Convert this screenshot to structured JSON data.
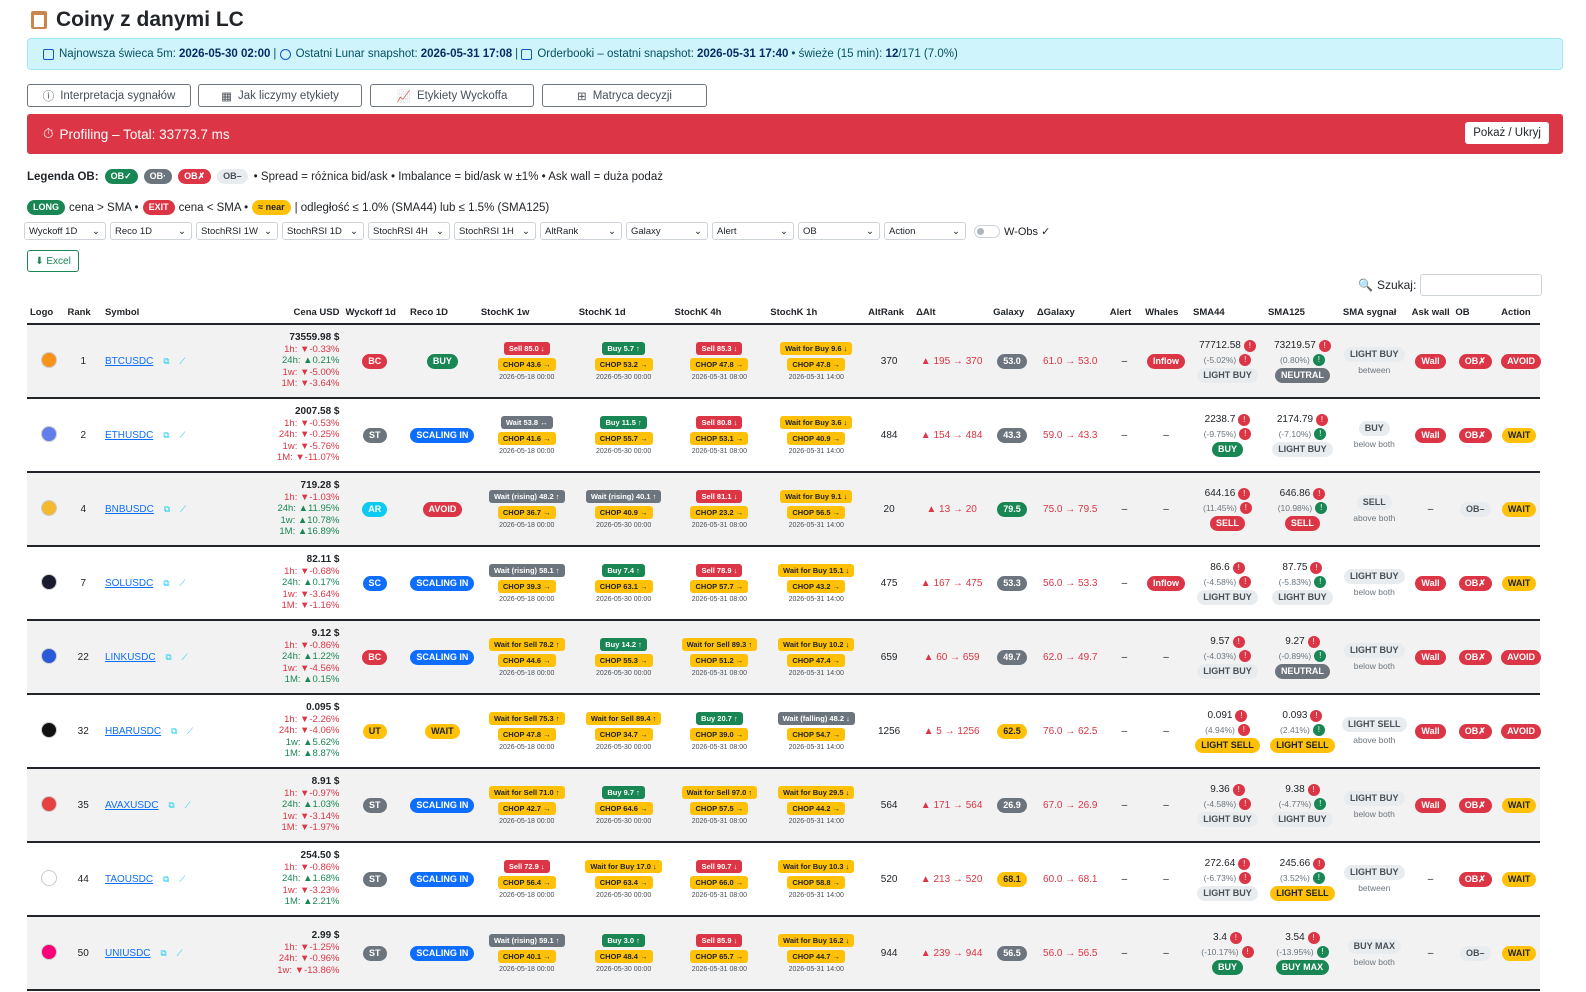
{
  "title": "Coiny z danymi LC",
  "info": {
    "candle_label": "Najnowsza świeca 5m:",
    "candle_val": "2026-05-30 02:00",
    "lunar_label": "Ostatni Lunar snapshot:",
    "lunar_val": "2026-05-31 17:08",
    "ob_label": "Orderbooki – ostatni snapshot:",
    "ob_val": "2026-05-31 17:40",
    "fresh_label": "• świeże (15 min):",
    "fresh_val": "12",
    "fresh_tail": "/171 (7.0%)"
  },
  "tabs": [
    "Interpretacja sygnałów",
    "Jak liczymy etykiety",
    "Etykiety Wyckoffa",
    "Matryca decyzji"
  ],
  "profiling": {
    "text": "Profiling – Total: 33773.7 ms",
    "toggle": "Pokaż / Ukryj"
  },
  "legend": {
    "label": "Legenda OB:",
    "ob_ok": "OB✓",
    "ob_neutral": "OB·",
    "ob_bad": "OB✗",
    "ob_none": "OB–",
    "desc": "• Spread = różnica bid/ask • Imbalance = bid/ask w ±1% • Ask wall = duża podaż"
  },
  "legend2": {
    "long": "LONG",
    "long_txt": "cena > SMA •",
    "exit": "EXIT",
    "exit_txt": "cena < SMA •",
    "near": "≈ near",
    "near_txt": "| odległość ≤ 1.0% (SMA44) lub ≤ 1.5% (SMA125)"
  },
  "filters": [
    "Wyckoff 1D",
    "Reco 1D",
    "StochRSI 1W",
    "StochRSI 1D",
    "StochRSI 4H",
    "StochRSI 1H",
    "AltRank",
    "Galaxy",
    "Alert",
    "OB",
    "Action"
  ],
  "wobs": "W-Obs ✓",
  "excel": "Excel",
  "search_label": "Szukaj:",
  "headers": [
    "Logo",
    "Rank",
    "Symbol",
    "Cena USD",
    "Wyckoff 1d",
    "Reco 1D",
    "StochK 1w",
    "StochK 1d",
    "StochK 4h",
    "StochK 1h",
    "AltRank",
    "ΔAlt",
    "Galaxy",
    "ΔGalaxy",
    "Alert",
    "Whales",
    "SMA44",
    "SMA125",
    "SMA sygnał",
    "Ask wall",
    "OB",
    "Action"
  ],
  "rows": [
    {
      "logo": "#f7931a",
      "rank": "1",
      "sym": "BTCUSDC",
      "price": "73559.98 $",
      "h1": "1h: ▼-0.33%",
      "h24": "24h: ▲0.21%",
      "w1": "1w: ▼-5.00%",
      "m1": "1M: ▼-3.64%",
      "wy": "BC",
      "wyc": "r",
      "reco": "BUY",
      "recoc": "g",
      "s1": [
        "Sell 85.0 ↓",
        "r",
        "CHOP 43.6 →",
        "2026-05-18 00:00"
      ],
      "s2": [
        "Buy 5.7 ↑",
        "g",
        "CHOP 53.2 →",
        "2026-05-30 00:00"
      ],
      "s3": [
        "Sell 85.3 ↓",
        "r",
        "CHOP 47.8 →",
        "2026-05-31 08:00"
      ],
      "s4": [
        "Wait for Buy 9.6 ↓",
        "y",
        "CHOP 47.8 →",
        "2026-05-31 14:00"
      ],
      "alt": "370",
      "dalt": "▲ 195 → 370",
      "gal": "53.0",
      "galc": "gr",
      "dgal": "61.0 → 53.0",
      "alert": "–",
      "whale": "Inflow",
      "sma44": "77712.58",
      "sma44p": "(-5.02%)",
      "sma44l": "LIGHT BUY",
      "sma44c": "lg",
      "sma125": "73219.57",
      "sma125p": "(0.80%)",
      "sma125l": "NEUTRAL",
      "sma125c": "gr",
      "sig": "LIGHT BUY",
      "sigsub": "between",
      "ask": "Wall",
      "ob": "OB✗",
      "act": "AVOID",
      "actc": "r"
    },
    {
      "logo": "#627eea",
      "rank": "2",
      "sym": "ETHUSDC",
      "price": "2007.58 $",
      "h1": "1h: ▼-0.53%",
      "h24": "24h: ▼-0.25%",
      "w1": "1w: ▼-5.76%",
      "m1": "1M: ▼-11.07%",
      "wy": "ST",
      "wyc": "gr",
      "reco": "SCALING IN",
      "recoc": "b",
      "s1": [
        "Wait 53.8 ↔",
        "gr",
        "CHOP 41.6 →",
        "2026-05-18 00:00"
      ],
      "s2": [
        "Buy 11.5 ↑",
        "g",
        "CHOP 55.7 →",
        "2026-05-30 00:00"
      ],
      "s3": [
        "Sell 80.8 ↓",
        "r",
        "CHOP 53.1 →",
        "2026-05-31 08:00"
      ],
      "s4": [
        "Wait for Buy 3.6 ↓",
        "y",
        "CHOP 40.9 →",
        "2026-05-31 14:00"
      ],
      "alt": "484",
      "dalt": "▲ 154 → 484",
      "gal": "43.3",
      "galc": "gr",
      "dgal": "59.0 → 43.3",
      "alert": "–",
      "whale": "–",
      "sma44": "2238.7",
      "sma44p": "(-9.75%)",
      "sma44l": "BUY",
      "sma44c": "g",
      "sma125": "2174.79",
      "sma125p": "(-7.10%)",
      "sma125l": "LIGHT BUY",
      "sma125c": "lg",
      "sig": "BUY",
      "sigsub": "below both",
      "ask": "Wall",
      "ob": "OB✗",
      "act": "WAIT",
      "actc": "y"
    },
    {
      "logo": "#f3ba2f",
      "rank": "4",
      "sym": "BNBUSDC",
      "price": "719.28 $",
      "h1": "1h: ▼-1.03%",
      "h24": "24h: ▲11.95%",
      "w1": "1w: ▲10.78%",
      "m1": "1M: ▲16.89%",
      "wy": "AR",
      "wyc": "c",
      "reco": "AVOID",
      "recoc": "r",
      "s1": [
        "Wait (rising) 48.2 ↑",
        "gr",
        "CHOP 36.7 →",
        "2026-05-18 00:00"
      ],
      "s2": [
        "Wait (rising) 40.1 ↑",
        "gr",
        "CHOP 40.9 →",
        "2026-05-30 00:00"
      ],
      "s3": [
        "Sell 81.1 ↓",
        "r",
        "CHOP 23.2 →",
        "2026-05-31 08:00"
      ],
      "s4": [
        "Wait for Buy 9.1 ↓",
        "y",
        "CHOP 56.5 →",
        "2026-05-31 14:00"
      ],
      "alt": "20",
      "dalt": "▲ 13 → 20",
      "gal": "79.5",
      "galc": "g",
      "dgal": "75.0 → 79.5",
      "alert": "–",
      "whale": "–",
      "sma44": "644.16",
      "sma44p": "(11.45%)",
      "sma44l": "SELL",
      "sma44c": "r",
      "sma125": "646.86",
      "sma125p": "(10.98%)",
      "sma125l": "SELL",
      "sma125c": "r",
      "sig": "SELL",
      "sigsub": "above both",
      "ask": "–",
      "ob": "OB–",
      "act": "WAIT",
      "actc": "y"
    },
    {
      "logo": "#1b1b2f",
      "rank": "7",
      "sym": "SOLUSDC",
      "price": "82.11 $",
      "h1": "1h: ▼-0.68%",
      "h24": "24h: ▲0.17%",
      "w1": "1w: ▼-3.64%",
      "m1": "1M: ▼-1.16%",
      "wy": "SC",
      "wyc": "b",
      "reco": "SCALING IN",
      "recoc": "b",
      "s1": [
        "Wait (rising) 58.1 ↑",
        "gr",
        "CHOP 39.3 →",
        "2026-05-18 00:00"
      ],
      "s2": [
        "Buy 7.4 ↑",
        "g",
        "CHOP 63.1 →",
        "2026-05-30 00:00"
      ],
      "s3": [
        "Sell 78.9 ↓",
        "r",
        "CHOP 57.7 →",
        "2026-05-31 08:00"
      ],
      "s4": [
        "Wait for Buy 15.1 ↓",
        "y",
        "CHOP 43.2 →",
        "2026-05-31 14:00"
      ],
      "alt": "475",
      "dalt": "▲ 167 → 475",
      "gal": "53.3",
      "galc": "gr",
      "dgal": "56.0 → 53.3",
      "alert": "–",
      "whale": "Inflow",
      "sma44": "86.6",
      "sma44p": "(-4.58%)",
      "sma44l": "LIGHT BUY",
      "sma44c": "lg",
      "sma125": "87.75",
      "sma125p": "(-5.83%)",
      "sma125l": "LIGHT BUY",
      "sma125c": "lg",
      "sig": "LIGHT BUY",
      "sigsub": "below both",
      "ask": "Wall",
      "ob": "OB✗",
      "act": "WAIT",
      "actc": "y"
    },
    {
      "logo": "#2a5ada",
      "rank": "22",
      "sym": "LINKUSDC",
      "price": "9.12 $",
      "h1": "1h: ▼-0.86%",
      "h24": "24h: ▲1.22%",
      "w1": "1w: ▼-4.56%",
      "m1": "1M: ▲0.15%",
      "wy": "BC",
      "wyc": "r",
      "reco": "SCALING IN",
      "recoc": "b",
      "s1": [
        "Wait for Sell 78.2 ↑",
        "y",
        "CHOP 44.6 →",
        "2026-05-18 00:00"
      ],
      "s2": [
        "Buy 14.2 ↑",
        "g",
        "CHOP 55.3 →",
        "2026-05-30 00:00"
      ],
      "s3": [
        "Wait for Sell 89.3 ↑",
        "y",
        "CHOP 51.2 →",
        "2026-05-31 08:00"
      ],
      "s4": [
        "Wait for Buy 10.2 ↓",
        "y",
        "CHOP 47.4 →",
        "2026-05-31 14:00"
      ],
      "alt": "659",
      "dalt": "▲ 60 → 659",
      "gal": "49.7",
      "galc": "gr",
      "dgal": "62.0 → 49.7",
      "alert": "–",
      "whale": "–",
      "sma44": "9.57",
      "sma44p": "(-4.03%)",
      "sma44l": "LIGHT BUY",
      "sma44c": "lg",
      "sma125": "9.27",
      "sma125p": "(-0.89%)",
      "sma125l": "NEUTRAL",
      "sma125c": "gr",
      "sig": "LIGHT BUY",
      "sigsub": "below both",
      "ask": "Wall",
      "ob": "OB✗",
      "act": "AVOID",
      "actc": "r"
    },
    {
      "logo": "#111111",
      "rank": "32",
      "sym": "HBARUSDC",
      "price": "0.095 $",
      "h1": "1h: ▼-2.26%",
      "h24": "24h: ▼-4.06%",
      "w1": "1w: ▲5.62%",
      "m1": "1M: ▲8.87%",
      "wy": "UT",
      "wyc": "y",
      "reco": "WAIT",
      "recoc": "y",
      "s1": [
        "Wait for Sell 75.3 ↑",
        "y",
        "CHOP 47.8 →",
        "2026-05-18 00:00"
      ],
      "s2": [
        "Wait for Sell 89.4 ↑",
        "y",
        "CHOP 34.7 →",
        "2026-05-30 00:00"
      ],
      "s3": [
        "Buy 20.7 ↑",
        "g",
        "CHOP 39.0 →",
        "2026-05-31 08:00"
      ],
      "s4": [
        "Wait (falling) 48.2 ↓",
        "gr",
        "CHOP 54.7 →",
        "2026-05-31 14:00"
      ],
      "alt": "1256",
      "dalt": "▲ 5 → 1256",
      "gal": "62.5",
      "galc": "y",
      "dgal": "76.0 → 62.5",
      "alert": "–",
      "whale": "–",
      "sma44": "0.091",
      "sma44p": "(4.94%)",
      "sma44l": "LIGHT SELL",
      "sma44c": "y",
      "sma125": "0.093",
      "sma125p": "(2.41%)",
      "sma125l": "LIGHT SELL",
      "sma125c": "y",
      "sig": "LIGHT SELL",
      "sigsub": "above both",
      "ask": "Wall",
      "ob": "OB✗",
      "act": "AVOID",
      "actc": "r"
    },
    {
      "logo": "#e84142",
      "rank": "35",
      "sym": "AVAXUSDC",
      "price": "8.91 $",
      "h1": "1h: ▼-0.97%",
      "h24": "24h: ▲1.03%",
      "w1": "1w: ▼-3.14%",
      "m1": "1M: ▼-1.97%",
      "wy": "ST",
      "wyc": "gr",
      "reco": "SCALING IN",
      "recoc": "b",
      "s1": [
        "Wait for Sell 71.0 ↑",
        "y",
        "CHOP 42.7 →",
        "2026-05-18 00:00"
      ],
      "s2": [
        "Buy 9.7 ↑",
        "g",
        "CHOP 64.6 →",
        "2026-05-30 00:00"
      ],
      "s3": [
        "Wait for Sell 97.0 ↑",
        "y",
        "CHOP 57.5 →",
        "2026-05-31 08:00"
      ],
      "s4": [
        "Wait for Buy 29.5 ↓",
        "y",
        "CHOP 44.2 →",
        "2026-05-31 14:00"
      ],
      "alt": "564",
      "dalt": "▲ 171 → 564",
      "gal": "26.9",
      "galc": "gr",
      "dgal": "67.0 → 26.9",
      "alert": "–",
      "whale": "–",
      "sma44": "9.36",
      "sma44p": "(-4.58%)",
      "sma44l": "LIGHT BUY",
      "sma44c": "lg",
      "sma125": "9.38",
      "sma125p": "(-4.77%)",
      "sma125l": "LIGHT BUY",
      "sma125c": "lg",
      "sig": "LIGHT BUY",
      "sigsub": "below both",
      "ask": "Wall",
      "ob": "OB✗",
      "act": "WAIT",
      "actc": "y"
    },
    {
      "logo": "#ffffff",
      "rank": "44",
      "sym": "TAOUSDC",
      "price": "254.50 $",
      "h1": "1h: ▼-0.86%",
      "h24": "24h: ▲1.68%",
      "w1": "1w: ▼-3.23%",
      "m1": "1M: ▲2.21%",
      "wy": "ST",
      "wyc": "gr",
      "reco": "SCALING IN",
      "recoc": "b",
      "s1": [
        "Sell 72.9 ↓",
        "r",
        "CHOP 56.4 →",
        "2026-05-18 00:00"
      ],
      "s2": [
        "Wait for Buy 17.0 ↓",
        "y",
        "CHOP 63.4 →",
        "2026-05-30 00:00"
      ],
      "s3": [
        "Sell 90.7 ↓",
        "r",
        "CHOP 66.0 →",
        "2026-05-31 08:00"
      ],
      "s4": [
        "Wait for Buy 10.3 ↓",
        "y",
        "CHOP 58.8 →",
        "2026-05-31 14:00"
      ],
      "alt": "520",
      "dalt": "▲ 213 → 520",
      "gal": "68.1",
      "galc": "y",
      "dgal": "60.0 → 68.1",
      "alert": "–",
      "whale": "–",
      "sma44": "272.64",
      "sma44p": "(-6.73%)",
      "sma44l": "LIGHT BUY",
      "sma44c": "lg",
      "sma125": "245.66",
      "sma125p": "(3.52%)",
      "sma125l": "LIGHT SELL",
      "sma125c": "y",
      "sig": "LIGHT BUY",
      "sigsub": "between",
      "ask": "–",
      "ob": "OB✗",
      "act": "WAIT",
      "actc": "y"
    },
    {
      "logo": "#ff007a",
      "rank": "50",
      "sym": "UNIUSDC",
      "price": "2.99 $",
      "h1": "1h: ▼-1.25%",
      "h24": "24h: ▼-0.96%",
      "w1": "1w: ▼-13.86%",
      "m1": "",
      "wy": "ST",
      "wyc": "gr",
      "reco": "SCALING IN",
      "recoc": "b",
      "s1": [
        "Wait (rising) 59.1 ↑",
        "gr",
        "CHOP 40.1 →",
        "2026-05-18 00:00"
      ],
      "s2": [
        "Buy 3.0 ↑",
        "g",
        "CHOP 48.4 →",
        "2026-05-30 00:00"
      ],
      "s3": [
        "Sell 85.9 ↓",
        "r",
        "CHOP 65.7 →",
        "2026-05-31 08:00"
      ],
      "s4": [
        "Wait for Buy 16.2 ↓",
        "y",
        "CHOP 44.7 →",
        "2026-05-31 14:00"
      ],
      "alt": "944",
      "dalt": "▲ 239 → 944",
      "gal": "56.5",
      "galc": "gr",
      "dgal": "56.0 → 56.5",
      "alert": "–",
      "whale": "–",
      "sma44": "3.4",
      "sma44p": "(-10.17%)",
      "sma44l": "BUY",
      "sma44c": "g",
      "sma125": "3.54",
      "sma125p": "(-13.95%)",
      "sma125l": "BUY MAX",
      "sma125c": "g",
      "sig": "BUY MAX",
      "sigsub": "below both",
      "ask": "–",
      "ob": "OB–",
      "act": "WAIT",
      "actc": "y"
    }
  ]
}
